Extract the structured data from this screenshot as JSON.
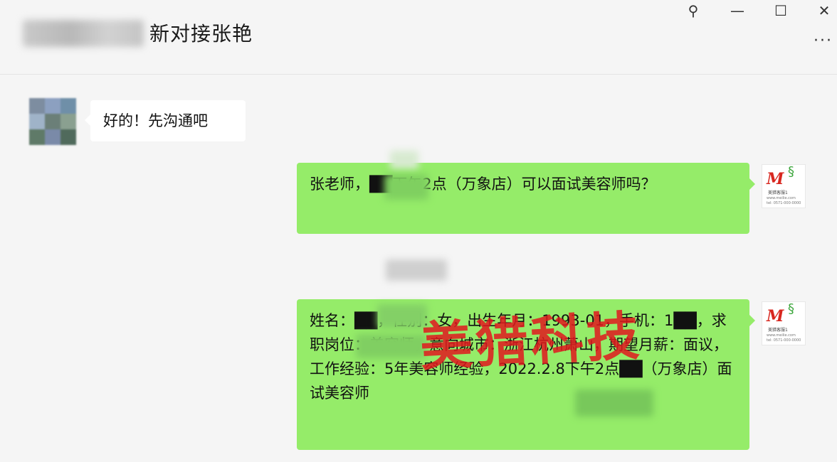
{
  "window": {
    "title": "新对接张艳",
    "controls": {
      "pin_icon": "pin-icon",
      "minimize_icon": "minimize-icon",
      "maximize_icon": "maximize-icon",
      "close_icon": "close-icon",
      "more_icon": "more-icon",
      "pin_glyph": "⚲",
      "minimize_glyph": "—",
      "maximize_glyph": "☐",
      "close_glyph": "✕",
      "more_glyph": "···"
    }
  },
  "messages": [
    {
      "sender": "contact",
      "text": "好的！先沟通吧"
    },
    {
      "sender": "self",
      "text": "张老师，██下午2点（万象店）可以面试美容师吗？"
    },
    {
      "sender": "self",
      "text": "姓名：██，性别：女，出生年月：1993-01，手机：1██，求职岗位：美容师，意向城市：浙江杭州萧山，期望月薪：面议，工作经验：5年美容师经验，2022.2.8下午2点██（万象店）面试美容师"
    }
  ],
  "avatar_right": {
    "logo": "M",
    "line1": "美猎客服1",
    "line2": "www.meilie.com",
    "line3": "tel: 0571-000-0000"
  },
  "watermark": "美猎科技",
  "colors": {
    "own_bubble": "#95ec69",
    "contact_bubble": "#ffffff",
    "background": "#f5f5f5",
    "watermark": "#e1191e"
  }
}
